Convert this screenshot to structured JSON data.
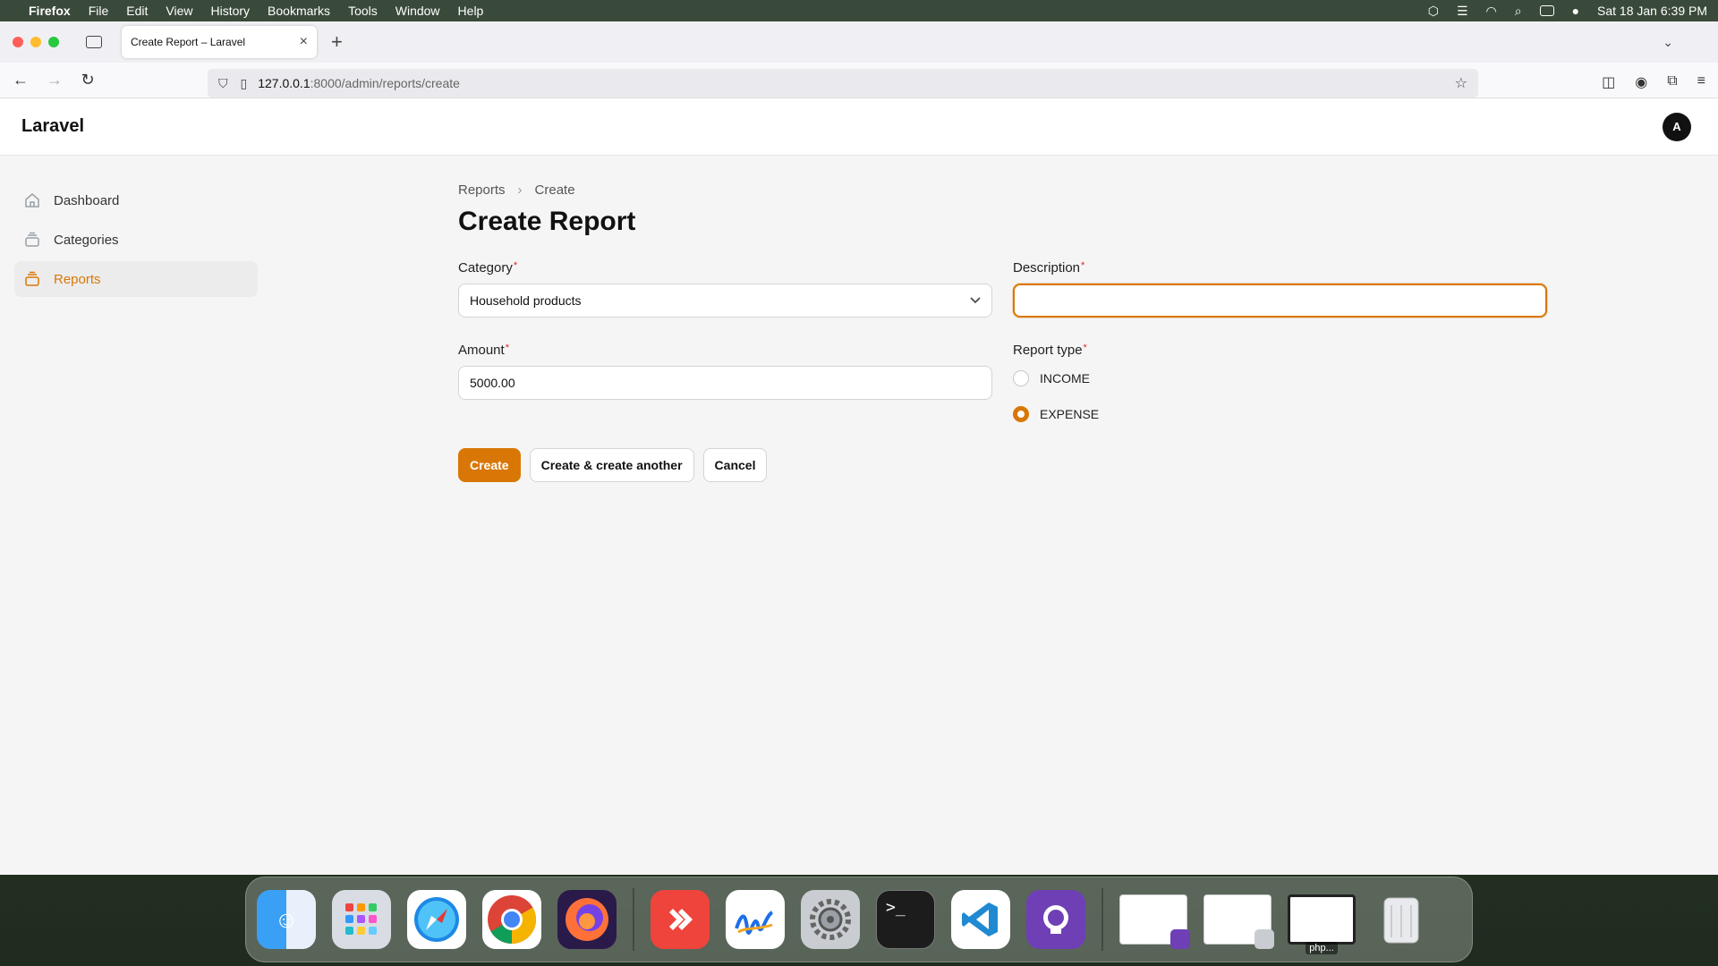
{
  "menubar": {
    "app": "Firefox",
    "items": [
      "File",
      "Edit",
      "View",
      "History",
      "Bookmarks",
      "Tools",
      "Window",
      "Help"
    ],
    "clock": "Sat 18 Jan  6:39 PM"
  },
  "browser": {
    "tab_title": "Create Report – Laravel",
    "url_host": "127.0.0.1",
    "url_path": ":8000/admin/reports/create"
  },
  "app": {
    "brand": "Laravel",
    "avatar_initial": "A",
    "sidebar": [
      {
        "label": "Dashboard",
        "icon": "home-icon",
        "active": false
      },
      {
        "label": "Categories",
        "icon": "stack-icon",
        "active": false
      },
      {
        "label": "Reports",
        "icon": "stack-icon",
        "active": true
      }
    ],
    "breadcrumb": {
      "parent": "Reports",
      "current": "Create"
    },
    "title": "Create Report",
    "form": {
      "category_label": "Category",
      "category_value": "Household products",
      "description_label": "Description",
      "description_value": "",
      "amount_label": "Amount",
      "amount_value": "5000.00",
      "report_type_label": "Report type",
      "report_type_options": [
        "INCOME",
        "EXPENSE"
      ],
      "report_type_selected": "EXPENSE",
      "required_mark": "*"
    },
    "actions": {
      "create": "Create",
      "create_another": "Create & create another",
      "cancel": "Cancel"
    }
  },
  "dock": {
    "apps": [
      "finder",
      "launchpad",
      "safari",
      "chrome",
      "firefox",
      "anydesk",
      "freeform",
      "system-settings",
      "terminal",
      "vscode",
      "github-desktop"
    ],
    "thumb_label": "php..."
  },
  "colors": {
    "accent": "#d97706",
    "required": "#dc2626"
  }
}
